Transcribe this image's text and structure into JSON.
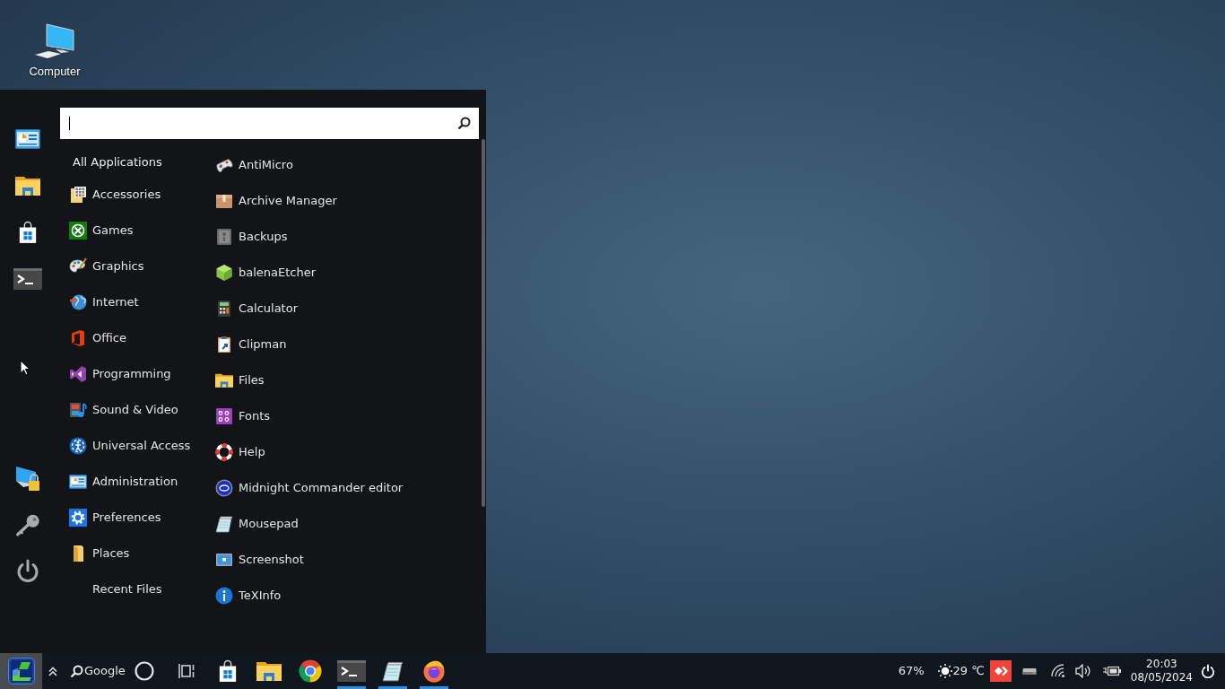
{
  "desktop": {
    "icons": [
      {
        "label": "Computer"
      }
    ]
  },
  "start_menu": {
    "search": {
      "focused": true
    },
    "categories": [
      {
        "label": "All Applications",
        "kind": "all"
      },
      {
        "label": "Accessories",
        "kind": "category"
      },
      {
        "label": "Games",
        "kind": "category"
      },
      {
        "label": "Graphics",
        "kind": "category"
      },
      {
        "label": "Internet",
        "kind": "category"
      },
      {
        "label": "Office",
        "kind": "category"
      },
      {
        "label": "Programming",
        "kind": "category"
      },
      {
        "label": "Sound & Video",
        "kind": "category"
      },
      {
        "label": "Universal Access",
        "kind": "category"
      },
      {
        "label": "Administration",
        "kind": "category"
      },
      {
        "label": "Preferences",
        "kind": "category"
      },
      {
        "label": "Places",
        "kind": "category"
      },
      {
        "label": "Recent Files",
        "kind": "recent"
      }
    ],
    "apps": [
      "AntiMicro",
      "Archive Manager",
      "Backups",
      "balenaEtcher",
      "Calculator",
      "Clipman",
      "Files",
      "Fonts",
      "Help",
      "Midnight Commander editor",
      "Mousepad",
      "Screenshot",
      "TeXInfo"
    ]
  },
  "taskbar": {
    "start_button": {
      "pressed": true
    },
    "search_label": "Google",
    "pinned": [
      {
        "running": false
      },
      {
        "running": false
      },
      {
        "running": false
      },
      {
        "running": true
      },
      {
        "running": true
      },
      {
        "running": true
      }
    ]
  },
  "tray": {
    "percent": "67%",
    "weather": "29 ℃",
    "time": "20:03",
    "date": "08/05/2024"
  }
}
